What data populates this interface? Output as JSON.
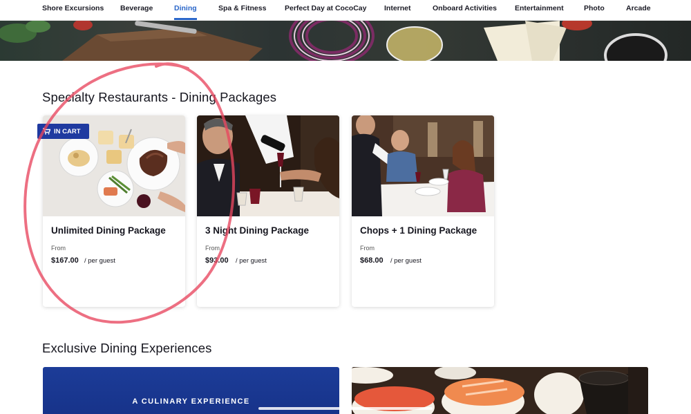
{
  "nav": {
    "items": [
      {
        "label": "Shore Excursions",
        "active": false
      },
      {
        "label": "Beverage",
        "active": false
      },
      {
        "label": "Dining",
        "active": true
      },
      {
        "label": "Spa & Fitness",
        "active": false
      },
      {
        "label": "Perfect Day at CocoCay",
        "active": false
      },
      {
        "label": "Internet",
        "active": false
      },
      {
        "label": "Onboard Activities",
        "active": false
      },
      {
        "label": "Entertainment",
        "active": false
      },
      {
        "label": "Photo",
        "active": false
      },
      {
        "label": "Arcade",
        "active": false
      }
    ]
  },
  "sections": {
    "specialty_title": "Specialty Restaurants - Dining Packages",
    "exclusive_title": "Exclusive Dining Experiences"
  },
  "packages": [
    {
      "title": "Unlimited Dining Package",
      "from_label": "From",
      "price": "$167.00",
      "per": "/ per guest",
      "badge": "IN CART"
    },
    {
      "title": "3 Night Dining Package",
      "from_label": "From",
      "price": "$93.00",
      "per": "/ per guest"
    },
    {
      "title": "Chops + 1 Dining Package",
      "from_label": "From",
      "price": "$68.00",
      "per": "/ per guest"
    }
  ],
  "experiences": {
    "left_tag": "A CULINARY EXPERIENCE"
  },
  "colors": {
    "accent": "#2a66c9",
    "badge": "#1f3aa0",
    "annotation_circle": "#e8465f"
  }
}
